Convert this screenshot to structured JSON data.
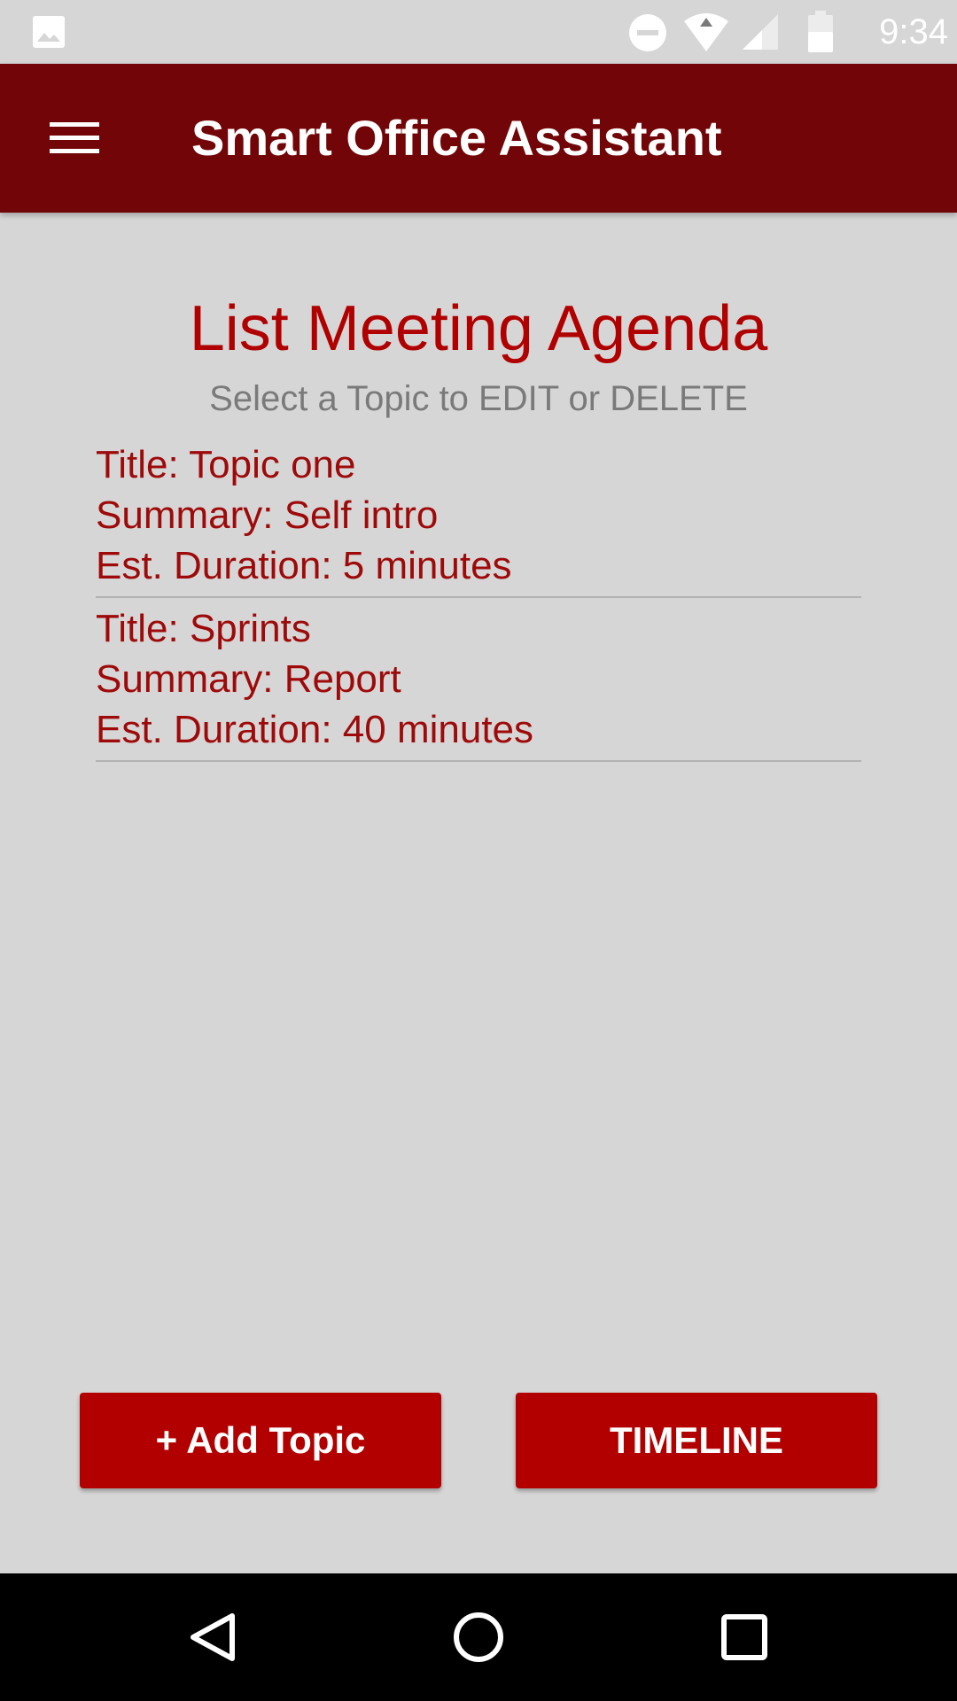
{
  "status_bar": {
    "time": "9:34",
    "icons": [
      "gallery-icon",
      "do-not-disturb-icon",
      "wifi-icon",
      "cell-signal-icon",
      "battery-icon"
    ]
  },
  "app_bar": {
    "title": "Smart Office Assistant",
    "menu_icon": "hamburger-menu-icon"
  },
  "main": {
    "title": "List Meeting Agenda",
    "subtitle": "Select a Topic to EDIT or DELETE",
    "topics": [
      {
        "title": "Title: Topic one",
        "summary": "Summary: Self intro",
        "duration": "Est. Duration: 5 minutes"
      },
      {
        "title": "Title: Sprints",
        "summary": "Summary: Report",
        "duration": "Est. Duration: 40 minutes"
      }
    ]
  },
  "actions": {
    "add_topic_label": "+ Add Topic",
    "timeline_label": "TIMELINE"
  },
  "nav_bar": {
    "icons": [
      "back-icon",
      "home-icon",
      "recents-icon"
    ]
  },
  "colors": {
    "app_bar": "#720507",
    "accent": "#b20000",
    "topic_text": "#9e0a0a",
    "background": "#d6d6d6"
  }
}
